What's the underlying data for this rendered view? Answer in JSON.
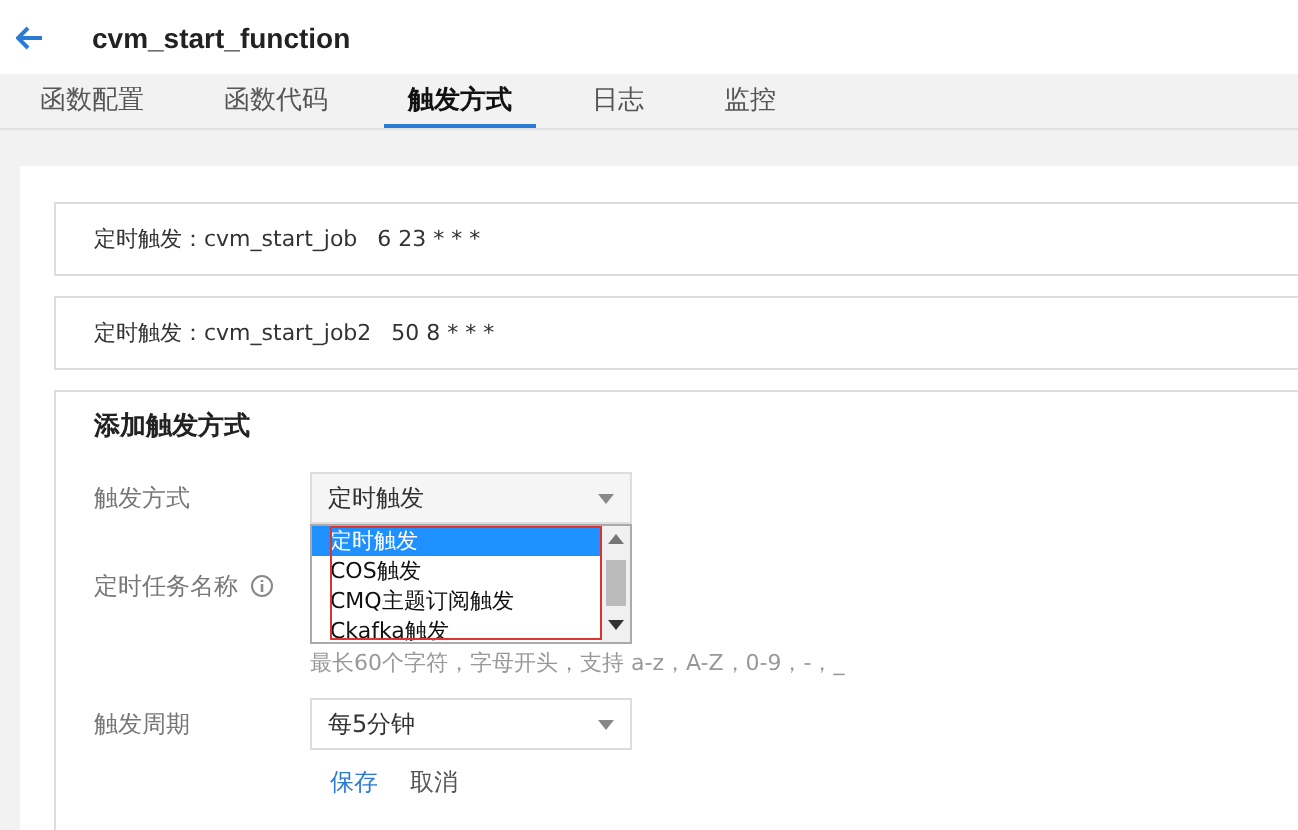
{
  "header": {
    "title": "cvm_start_function"
  },
  "tabs": [
    {
      "label": "函数配置",
      "selected": false
    },
    {
      "label": "函数代码",
      "selected": false
    },
    {
      "label": "触发方式",
      "selected": true
    },
    {
      "label": "日志",
      "selected": false
    },
    {
      "label": "监控",
      "selected": false
    }
  ],
  "triggers": [
    {
      "label": "定时触发：",
      "name": "cvm_start_job",
      "schedule": "6 23 * * *"
    },
    {
      "label": "定时触发：",
      "name": "cvm_start_job2",
      "schedule": "50 8 * * *"
    }
  ],
  "add_form": {
    "heading": "添加触发方式",
    "trigger_type": {
      "label": "触发方式",
      "value": "定时触发",
      "expanded": true,
      "options": [
        {
          "label": "定时触发",
          "selected": true
        },
        {
          "label": "COS触发",
          "selected": false
        },
        {
          "label": "CMQ主题订阅触发",
          "selected": false
        },
        {
          "label": "Ckafka触发",
          "selected": false
        }
      ]
    },
    "task_name": {
      "label": "定时任务名称",
      "hint": "最长60个字符，字母开头，支持 a-z，A-Z，0-9，-，_"
    },
    "period": {
      "label": "触发周期",
      "value": "每5分钟"
    },
    "save": "保存",
    "cancel": "取消"
  }
}
